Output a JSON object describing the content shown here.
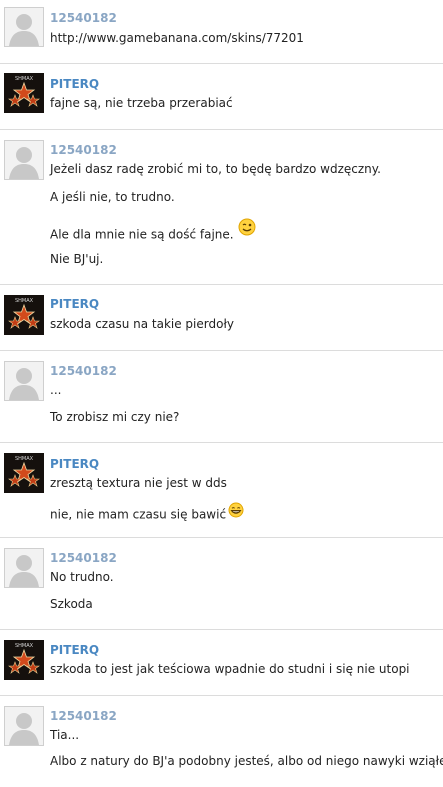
{
  "users": {
    "anon": "12540182",
    "piterq": "PITERQ"
  },
  "avatars": {
    "piterq_logo_text": "SHMAX"
  },
  "messages": [
    {
      "author": "12540182",
      "lines": [
        "http://www.gamebanana.com/skins/77201"
      ]
    },
    {
      "author": "PITERQ",
      "lines": [
        "fajne są, nie trzeba przerabiać"
      ]
    },
    {
      "author": "12540182",
      "lines": [
        "Jeżeli dasz radę zrobić mi to, to będę bardzo wdzęczny.",
        "A jeśli nie, to trudno.",
        "Ale dla mnie nie są dość fajne.",
        "Nie BJ'uj."
      ]
    },
    {
      "author": "PITERQ",
      "lines": [
        "szkoda czasu na takie pierdoły"
      ]
    },
    {
      "author": "12540182",
      "lines": [
        "...",
        "To zrobisz mi czy nie?"
      ]
    },
    {
      "author": "PITERQ",
      "lines": [
        "zresztą textura nie jest w dds",
        "nie, nie mam czasu się bawić"
      ]
    },
    {
      "author": "12540182",
      "lines": [
        "No trudno.",
        "Szkoda"
      ]
    },
    {
      "author": "PITERQ",
      "lines": [
        "szkoda to jest jak teściowa wpadnie do studni i się nie utopi"
      ]
    },
    {
      "author": "12540182",
      "lines": [
        "Tia...",
        "Albo z natury do BJ'a podobny jesteś, albo od niego nawyki wziąłeś..."
      ]
    }
  ],
  "icons": {
    "default_avatar": "user-silhouette-icon",
    "wink_emoji": "wink-emoji-icon",
    "grin_emoji": "grin-emoji-icon"
  },
  "colors": {
    "anon_name": "#8aa6c4",
    "piterq_name": "#4a88c2",
    "text": "#222222",
    "separator": "#dcdcdc"
  }
}
